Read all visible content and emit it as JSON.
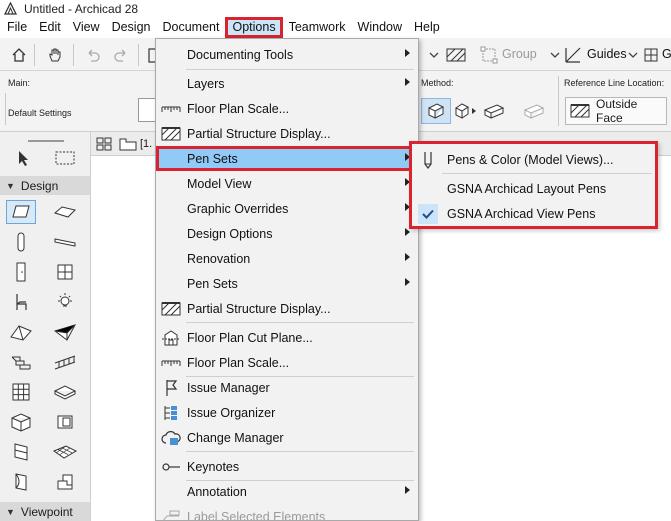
{
  "window": {
    "title": "Untitled - Archicad 28"
  },
  "menubar": {
    "items": [
      {
        "label": "File"
      },
      {
        "label": "Edit"
      },
      {
        "label": "View"
      },
      {
        "label": "Design"
      },
      {
        "label": "Document"
      },
      {
        "label": "Options",
        "active": true
      },
      {
        "label": "Teamwork"
      },
      {
        "label": "Window"
      },
      {
        "label": "Help"
      }
    ]
  },
  "toolbar": {
    "group_label": "Group",
    "guides_label": "Guides",
    "trailing_label": "G"
  },
  "infobox": {
    "main_label": "Main:",
    "default_settings": "Default Settings",
    "method_label": "Method:",
    "ref_line_label": "Reference Line Location:",
    "ref_line_value": "Outside Face"
  },
  "tabs": {
    "active_tab": "[1."
  },
  "toolbox": {
    "design_header": "Design",
    "viewpoint_header": "Viewpoint"
  },
  "options_menu": {
    "items": [
      {
        "label": "Documenting Tools",
        "submenu": true,
        "icon": "none"
      },
      {
        "label": "Layers",
        "submenu": true,
        "icon": "none"
      },
      {
        "label": "Floor Plan Scale...",
        "icon": "scale-ruler-icon"
      },
      {
        "label": "Partial Structure Display...",
        "icon": "hatch-icon"
      },
      {
        "label": "Pen Sets",
        "submenu": true,
        "highlighted": true,
        "icon": "none"
      },
      {
        "label": "Model View",
        "submenu": true,
        "icon": "none"
      },
      {
        "label": "Graphic Overrides",
        "submenu": true,
        "icon": "none"
      },
      {
        "label": "Design Options",
        "submenu": true,
        "icon": "none"
      },
      {
        "label": "Renovation",
        "submenu": true,
        "icon": "none"
      },
      {
        "label": "Pen Sets",
        "submenu": true,
        "icon": "none"
      },
      {
        "label": "Partial Structure Display...",
        "icon": "hatch-icon"
      },
      {
        "label": "Floor Plan Cut Plane...",
        "icon": "cut-plane-icon"
      },
      {
        "label": "Floor Plan Scale...",
        "icon": "scale-ruler-icon"
      },
      {
        "label": "Issue Manager",
        "icon": "flag-icon"
      },
      {
        "label": "Issue Organizer",
        "icon": "organizer-icon"
      },
      {
        "label": "Change Manager",
        "icon": "cloud-icon"
      },
      {
        "label": "Keynotes",
        "icon": "keynote-icon"
      },
      {
        "label": "Annotation",
        "submenu": true,
        "icon": "none"
      },
      {
        "label": "Label Selected Elements",
        "disabled": true,
        "icon": "label-icon"
      }
    ]
  },
  "pen_sets_submenu": {
    "items": [
      {
        "label": "Pens & Color (Model Views)...",
        "icon": "pen-icon",
        "underline_char": "P"
      },
      {
        "label": "GSNA Archicad Layout Pens",
        "icon": "none"
      },
      {
        "label": "GSNA Archicad View Pens",
        "icon": "checkmark-icon",
        "checked": true
      }
    ]
  },
  "colors": {
    "highlight_red": "#d9232e",
    "menu_highlight_blue": "#91c9f7",
    "menu_bg": "#f2f2f2",
    "toolbox_selected": "#d7e8f7"
  }
}
